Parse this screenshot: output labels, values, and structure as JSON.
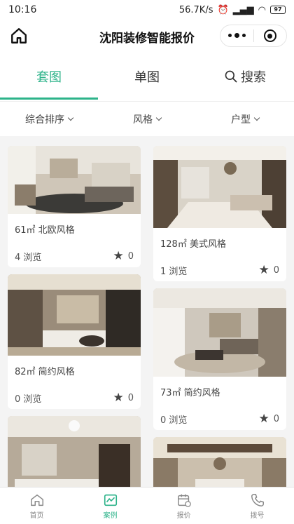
{
  "status": {
    "time": "10:16",
    "speed": "56.7K/s",
    "battery": "97"
  },
  "header": {
    "title": "沈阳装修智能报价"
  },
  "tabs": [
    {
      "label": "套图",
      "active": true
    },
    {
      "label": "单图",
      "active": false
    },
    {
      "label": "搜索",
      "active": false
    }
  ],
  "filters": [
    "综合排序",
    "风格",
    "户型"
  ],
  "cards_left": [
    {
      "name": "61㎡ 北欧风格",
      "views": "4 浏览",
      "likes": "0"
    },
    {
      "name": "82㎡ 简约风格",
      "views": "0 浏览",
      "likes": "0"
    },
    {
      "name": "",
      "views": "",
      "likes": ""
    }
  ],
  "cards_right": [
    {
      "name": "128㎡ 美式风格",
      "views": "1 浏览",
      "likes": "0"
    },
    {
      "name": "73㎡ 简约风格",
      "views": "0 浏览",
      "likes": "0"
    },
    {
      "name": "",
      "views": "",
      "likes": ""
    }
  ],
  "nav": [
    {
      "label": "首页",
      "icon": "home-icon",
      "active": false
    },
    {
      "label": "案例",
      "icon": "case-icon",
      "active": true
    },
    {
      "label": "报价",
      "icon": "calendar-icon",
      "active": false
    },
    {
      "label": "拨号",
      "icon": "phone-icon",
      "active": false
    }
  ],
  "colors": {
    "accent": "#2db38a"
  }
}
